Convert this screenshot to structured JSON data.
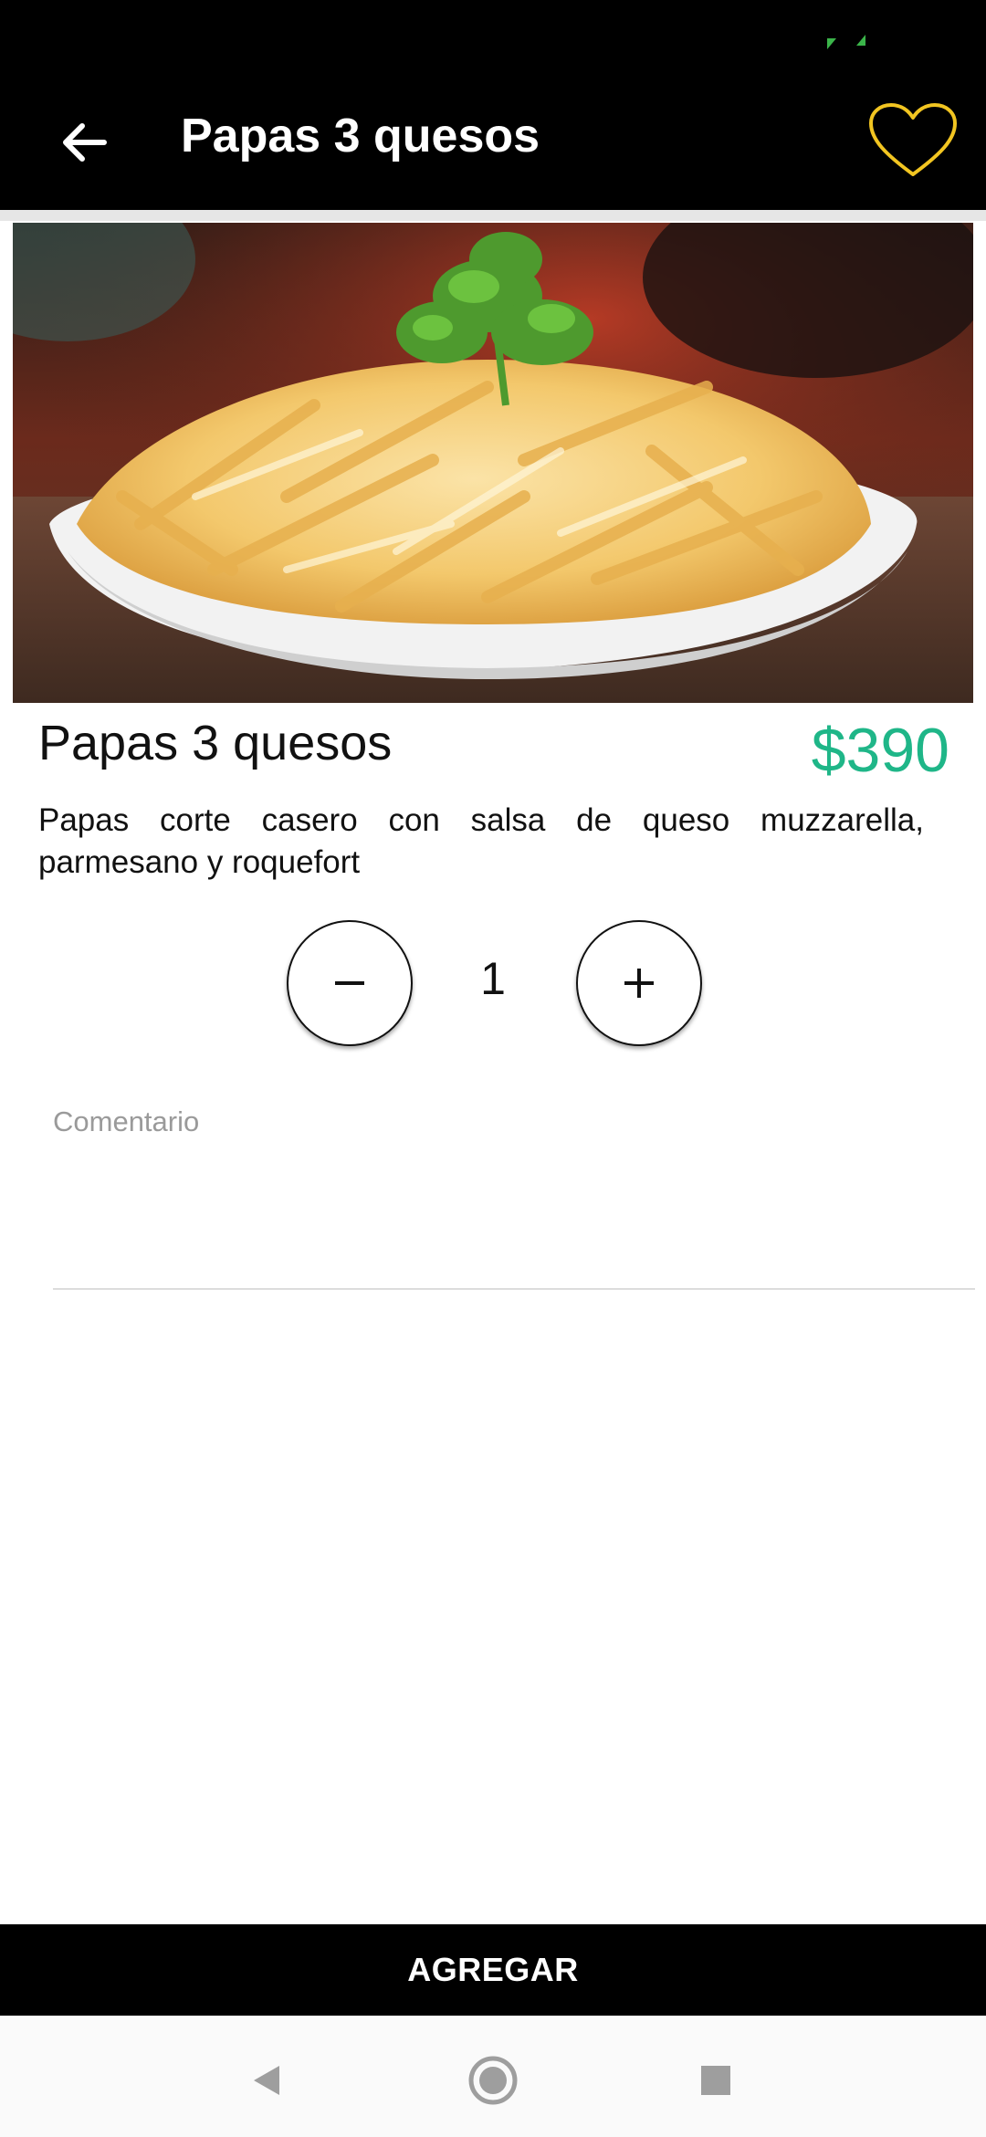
{
  "app_bar": {
    "title": "Papas 3 quesos",
    "back_icon": "arrow-left-icon",
    "favorite_icon": "heart-outline-icon",
    "favorite_color": "#f2c521"
  },
  "product": {
    "name": "Papas 3 quesos",
    "price": "$390",
    "price_color": "#1fb688",
    "description": "Papas corte casero con salsa de queso muzzarella, parmesano y roquefort"
  },
  "quantity": {
    "value": "1",
    "decrement_icon": "minus-icon",
    "increment_icon": "plus-icon"
  },
  "comment": {
    "placeholder": "Comentario",
    "value": ""
  },
  "actions": {
    "add_label": "AGREGAR"
  },
  "system_nav": {
    "back_icon": "nav-back-icon",
    "home_icon": "nav-home-icon",
    "recents_icon": "nav-recents-icon"
  },
  "status_bar": {
    "icon": "screen-rotate-icon",
    "icon_color": "#3bb54a"
  }
}
